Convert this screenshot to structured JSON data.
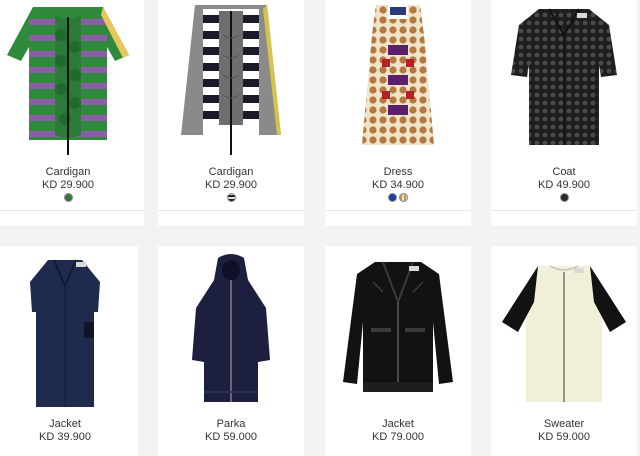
{
  "products": [
    {
      "name": "Cardigan",
      "price": "KD 29.900",
      "swatches": [
        {
          "color": "#2f7a3b",
          "icon": "green-stripe-swatch"
        }
      ]
    },
    {
      "name": "Cardigan",
      "price": "KD 29.900",
      "swatches": [
        {
          "color": "#333333",
          "icon": "black-stripe-swatch"
        }
      ]
    },
    {
      "name": "Dress",
      "price": "KD 34.900",
      "swatches": [
        {
          "color": "#1a3fa8",
          "icon": "blue-swatch"
        },
        {
          "color": "#c9935a",
          "icon": "orange-check-swatch"
        }
      ]
    },
    {
      "name": "Coat",
      "price": "KD 49.900",
      "swatches": [
        {
          "color": "#2a2a2a",
          "icon": "black-dot-swatch"
        }
      ]
    },
    {
      "name": "Jacket",
      "price": "KD 39.900",
      "swatches": []
    },
    {
      "name": "Parka",
      "price": "KD 59.000",
      "swatches": []
    },
    {
      "name": "Jacket",
      "price": "KD 79.000",
      "swatches": []
    },
    {
      "name": "Sweater",
      "price": "KD 59.000",
      "swatches": []
    }
  ],
  "colors": {
    "background": "#f3f3f3",
    "card": "#ffffff",
    "text": "#333333"
  }
}
